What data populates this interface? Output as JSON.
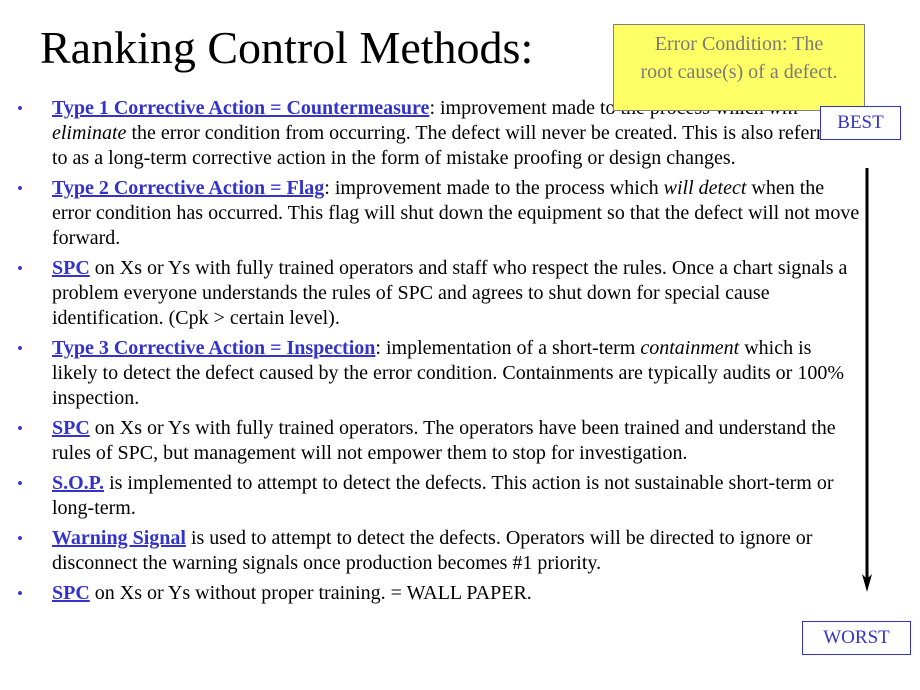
{
  "slide": {
    "title": "Ranking Control Methods:",
    "note": {
      "line1": "Error Condition:  The",
      "line2": "root cause(s) of a defect.",
      "background": "#ffff66"
    },
    "scale": {
      "best_label": "BEST",
      "worst_label": "WORST",
      "direction": "down-arrow-icon"
    },
    "accent_color": "#3333cc",
    "bullets": [
      {
        "link": "Type 1 Corrective Action = Countermeasure",
        "parts": [
          ":  improvement made to the process which ",
          "will eliminate",
          " the error condition from occurring.  The defect will never be created.  This is also referred to as a long-term corrective action in the form of mistake proofing or design changes."
        ]
      },
      {
        "link": "Type 2 Corrective Action = Flag",
        "parts": [
          ":  improvement made to the process which ",
          "will detect",
          " when the error condition has occurred.  This flag will shut down the equipment so that the defect will not move forward."
        ]
      },
      {
        "link": "SPC",
        "text": " on Xs or Ys with fully trained operators and staff who respect the rules.  Once a chart signals a problem everyone understands the rules of SPC and agrees to shut down for special cause identification. (Cpk > certain level)."
      },
      {
        "link": "Type 3 Corrective Action = Inspection",
        "parts": [
          ":  implementation of a short-term ",
          "containment",
          " which is likely to detect the defect caused by the error condition.  Containments are typically audits or 100% inspection."
        ]
      },
      {
        "link": "SPC",
        "text": " on Xs or Ys with fully trained operators.  The operators have been trained and understand the rules of SPC, but management will not empower them to stop for investigation."
      },
      {
        "link": "S.O.P.",
        "text": " is implemented to attempt to detect the defects.  This action is not sustainable short-term or long-term."
      },
      {
        "link": "Warning Signal",
        "text": " is used to attempt to detect the defects.  Operators will be directed to ignore or disconnect the warning signals once production becomes #1 priority."
      },
      {
        "link": "SPC",
        "text": " on Xs or Ys without proper training.  = WALL PAPER."
      }
    ]
  }
}
